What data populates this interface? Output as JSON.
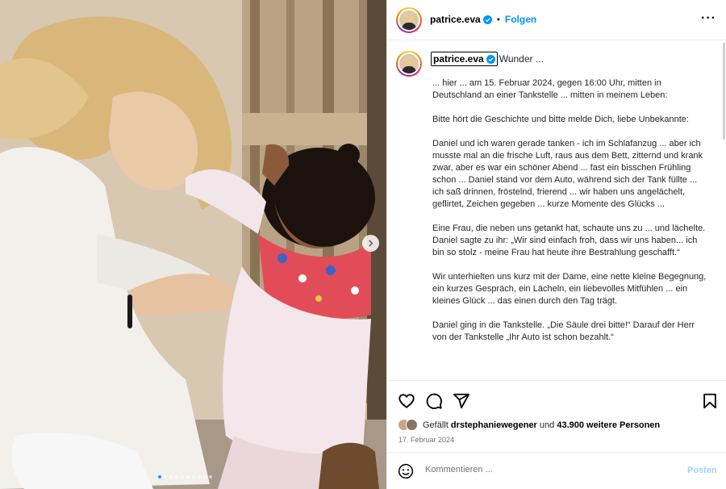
{
  "post": {
    "author": "patrice.eva",
    "follow_label": "Folgen",
    "separator": "•",
    "more_label": "···",
    "caption_title": "Wunder ...",
    "caption_paragraphs": [
      "... hier ... am 15. Februar 2024, gegen 16:00 Uhr, mitten in Deutschland an einer Tankstelle ... mitten in meinem Leben:",
      "Bitte hört die Geschichte und bitte melde Dich, liebe Unbekannte:",
      "Daniel und ich waren gerade tanken - ich im Schlafanzug ... aber ich musste mal an die frische Luft, raus aus dem Bett, zitternd und krank zwar, aber es war ein schöner Abend ... fast ein bisschen Frühling schon ... Daniel stand vor dem Auto, während sich der Tank füllte ... ich saß drinnen, fröstelnd, frierend ... wir haben uns angelächelt, geflirtet, Zeichen gegeben ... kurze Momente des Glücks ...",
      "Eine Frau, die neben uns getankt hat, schaute uns zu ... und lächelte. Daniel sagte zu ihr: „Wir sind einfach froh, dass wir uns haben... ich bin so stolz - meine Frau hat heute ihre Bestrahlung geschafft.“",
      "Wir unterhielten uns kurz mit der Dame, eine nette kleine Begegnung, ein kurzes Gespräch, ein Lächeln, ein liebevolles Mitfühlen ... ein kleines Glück ... das einen durch den Tag trägt.",
      "Daniel ging in die Tankstelle. „Die Säule drei bitte!“ Darauf der Herr von der Tankstelle „Ihr Auto ist schon bezahlt.“"
    ],
    "likes": {
      "prefix": "Gefällt",
      "user": "drstephaniewegener",
      "middle": "und",
      "count_text": "43.900 weitere Personen"
    },
    "date": "17. Februar 2024",
    "carousel": {
      "count": 10,
      "active_index": 0
    }
  },
  "comment": {
    "placeholder": "Kommentieren ...",
    "post_label": "Posten"
  },
  "icons": [
    "heart-icon",
    "comment-icon",
    "share-icon",
    "bookmark-icon",
    "emoji-icon",
    "verified-icon",
    "more-icon",
    "chevron-right-icon"
  ],
  "colors": {
    "link": "#0095f6",
    "verified": "#0095f6",
    "post_disabled": "#9fd0fa",
    "muted": "#737373"
  }
}
